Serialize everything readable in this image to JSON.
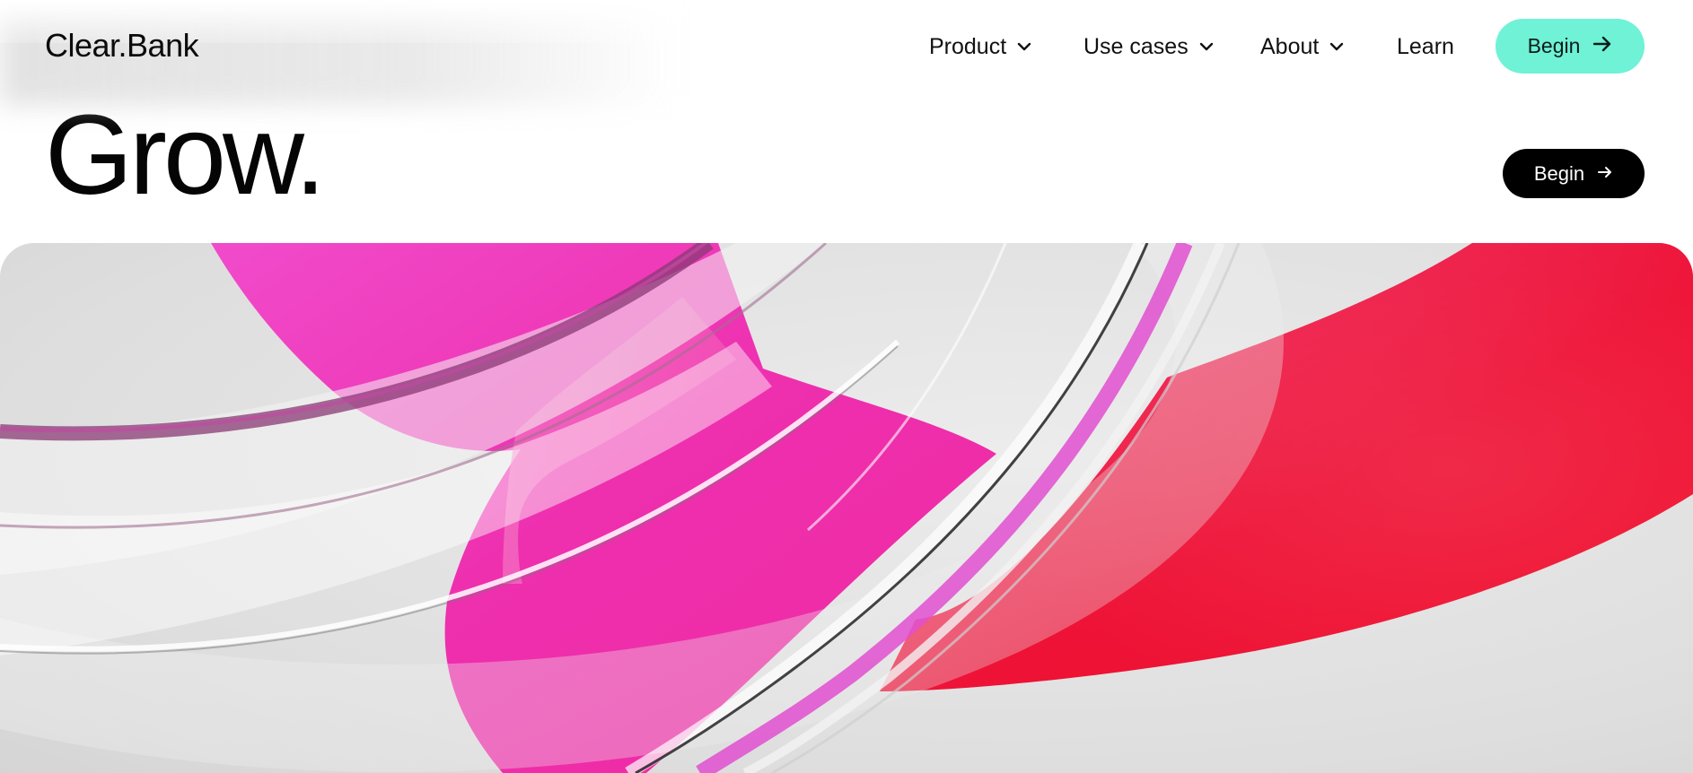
{
  "brand": {
    "name": "Clear.Bank"
  },
  "nav": {
    "items": [
      {
        "label": "Product",
        "has_dropdown": true,
        "icon": "chevron-down-icon"
      },
      {
        "label": "Use cases",
        "has_dropdown": true,
        "icon": "chevron-down-icon"
      },
      {
        "label": "About",
        "has_dropdown": true,
        "icon": "chevron-down-icon"
      },
      {
        "label": "Learn",
        "has_dropdown": false
      }
    ],
    "cta": {
      "label": "Begin",
      "icon": "arrow-right-icon",
      "color": "#6ff2d6"
    }
  },
  "hero": {
    "headline": "Grow.",
    "cta": {
      "label": "Begin",
      "icon": "arrow-right-icon",
      "color": "#000000"
    },
    "visual": {
      "description_colors": [
        "#ee2fae",
        "#ee1030",
        "#e2e2e2"
      ]
    }
  }
}
